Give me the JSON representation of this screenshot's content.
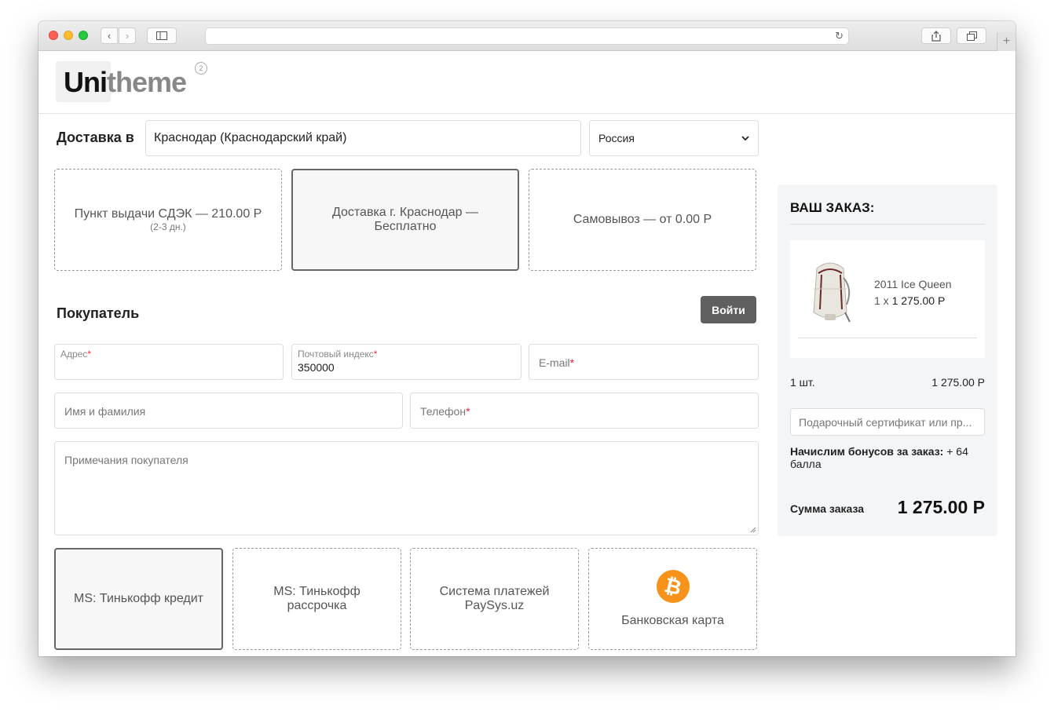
{
  "logo": {
    "part1": "Uni",
    "part2": "theme",
    "badge": "2"
  },
  "delivery": {
    "label": "Доставка в",
    "city": "Краснодар (Краснодарский край)",
    "country": "Россия"
  },
  "shipping_options": [
    {
      "title": "Пункт выдачи СДЭК — 210.00 Р",
      "sub": "(2-3 дн.)"
    },
    {
      "title": "Доставка г. Краснодар — Бесплатно"
    },
    {
      "title": "Самовывоз — от 0.00 Р"
    }
  ],
  "buyer": {
    "label": "Покупатель",
    "login": "Войти",
    "fields": {
      "address_label": "Адрес",
      "postcode_label": "Почтовый индекс",
      "postcode_value": "350000",
      "email_ph": "E-mail",
      "name_ph": "Имя и фамилия",
      "phone_ph": "Телефон",
      "notes_ph": "Примечания покупателя"
    },
    "required_mark": "*"
  },
  "payment_options": [
    {
      "title": "MS: Тинькофф кредит"
    },
    {
      "title": "MS: Тинькофф рассрочка"
    },
    {
      "title": "Система платежей PaySys.uz"
    },
    {
      "title": "Банковская карта",
      "icon": "bitcoin-icon"
    }
  ],
  "order": {
    "title": "ВАШ ЗАКАЗ:",
    "product_name": "2011 Ice Queen",
    "product_qty_prefix": "1 x",
    "product_price": "1 275.00 Р",
    "count": "1 шт.",
    "count_total": "1 275.00 Р",
    "coupon_ph": "Подарочный сертификат или пр...",
    "bonus_label": "Начислим бонусов за заказ:",
    "bonus_value": "+ 64 балла",
    "total_label": "Сумма заказа",
    "total_value": "1 275.00 Р"
  },
  "colors": {
    "accent_btn": "#5f5f5f",
    "required": "#ee2244",
    "bitcoin": "#f7931a"
  }
}
